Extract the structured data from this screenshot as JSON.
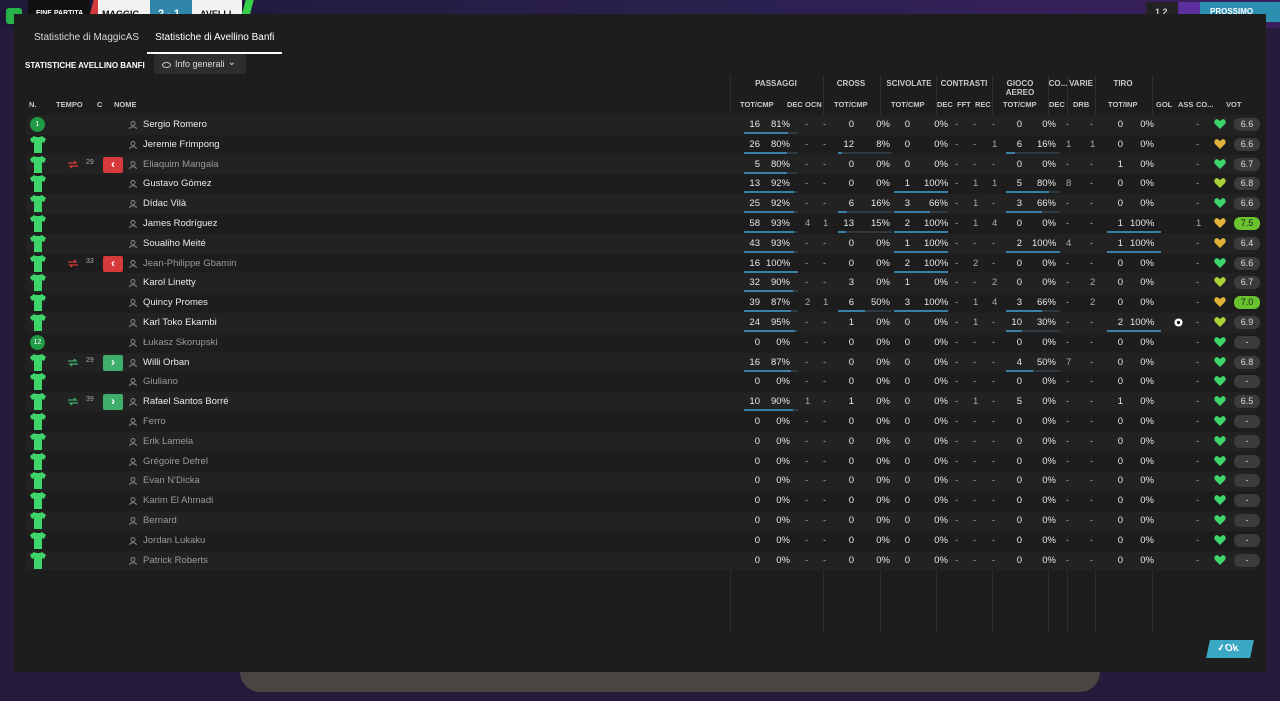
{
  "topbar": {
    "label": "FINE PARTITA",
    "home": "MAGGIC",
    "score": "2 - 1",
    "away": "AVELLI",
    "right_label": "1 2",
    "right_button": "PROSSIMO"
  },
  "tabs": [
    {
      "label": "Statistiche di MaggicAS",
      "active": false
    },
    {
      "label": "Statistiche di Avellino Banfi",
      "active": true
    }
  ],
  "section_title": "STATISTICHE AVELLINO BANFI",
  "view_select": {
    "value": "Info generali"
  },
  "groups": {
    "passaggi": "PASSAGGI",
    "cross": "CROSS",
    "scivolate": "SCIVOLATE",
    "contrasti": "CONTRASTI",
    "gioco_aereo": "GIOCO AEREO",
    "co": "CO...",
    "varie": "VARIE",
    "tiro": "TIRO"
  },
  "headers": {
    "n": "N.",
    "tempo": "TEMPO",
    "c": "C",
    "nome": "NOME",
    "pass_totcmp": "TOT/CMP",
    "pass_dec": "DEC",
    "pass_ocn": "OCN",
    "cross_totcmp": "TOT/CMP",
    "sciv_totcmp": "TOT/CMP",
    "con_dec": "DEC",
    "con_fft": "FFT",
    "con_rec": "REC",
    "aereo_totcmp": "TOT/CMP",
    "co_dec": "DEC",
    "varie_drb": "DRB",
    "tiro_totinp": "TOT/INP",
    "gol": "GOL",
    "ass": "ASS",
    "co2": "CO...",
    "vot": "VOT"
  },
  "players": [
    {
      "n": "1",
      "badge": true,
      "sub": "",
      "minute": "",
      "name": "Sergio Romero",
      "pass": [
        "16",
        "81%"
      ],
      "pdec": "-",
      "pocn": "-",
      "cross": [
        "0",
        "0%"
      ],
      "sciv": [
        "0",
        "0%"
      ],
      "cdec": "-",
      "cfft": "-",
      "crec": "-",
      "aereo": [
        "0",
        "0%"
      ],
      "codec": "-",
      "drb": "-",
      "tiro": [
        "0",
        "0%"
      ],
      "gol": "",
      "ass": "-",
      "heart": "#3ed66a",
      "vot": "6.6",
      "best": false,
      "bars": [
        0.81,
        0,
        0,
        0,
        0
      ]
    },
    {
      "n": "",
      "badge": false,
      "sub": "",
      "minute": "",
      "name": "Jeremie Frimpong",
      "pass": [
        "26",
        "80%"
      ],
      "pdec": "-",
      "pocn": "-",
      "cross": [
        "12",
        "8%"
      ],
      "sciv": [
        "0",
        "0%"
      ],
      "cdec": "-",
      "cfft": "-",
      "crec": "1",
      "aereo": [
        "6",
        "16%"
      ],
      "codec": "1",
      "drb": "1",
      "tiro": [
        "0",
        "0%"
      ],
      "gol": "",
      "ass": "-",
      "heart": "#e0b23a",
      "vot": "6.6",
      "best": false,
      "bars": [
        0.8,
        0.08,
        0,
        0.16,
        0
      ]
    },
    {
      "n": "",
      "badge": false,
      "sub": "out",
      "minute": "29",
      "name": "Eliaquim Mangala",
      "pass": [
        "5",
        "80%"
      ],
      "pdec": "-",
      "pocn": "-",
      "cross": [
        "0",
        "0%"
      ],
      "sciv": [
        "0",
        "0%"
      ],
      "cdec": "-",
      "cfft": "-",
      "crec": "-",
      "aereo": [
        "0",
        "0%"
      ],
      "codec": "-",
      "drb": "-",
      "tiro": [
        "1",
        "0%"
      ],
      "gol": "",
      "ass": "-",
      "heart": "#3ed66a",
      "vot": "6.7",
      "best": false,
      "bars": [
        0.8,
        0,
        0,
        0,
        0
      ]
    },
    {
      "n": "",
      "badge": false,
      "sub": "",
      "minute": "",
      "name": "Gustavo Gómez",
      "pass": [
        "13",
        "92%"
      ],
      "pdec": "-",
      "pocn": "-",
      "cross": [
        "0",
        "0%"
      ],
      "sciv": [
        "1",
        "100%"
      ],
      "cdec": "-",
      "cfft": "1",
      "crec": "1",
      "aereo": [
        "5",
        "80%"
      ],
      "codec": "8",
      "drb": "-",
      "tiro": [
        "0",
        "0%"
      ],
      "gol": "",
      "ass": "-",
      "heart": "#a8d43a",
      "vot": "6.8",
      "best": false,
      "bars": [
        0.92,
        0,
        1,
        0.8,
        0
      ]
    },
    {
      "n": "",
      "badge": false,
      "sub": "",
      "minute": "",
      "name": "Dídac Vilà",
      "pass": [
        "25",
        "92%"
      ],
      "pdec": "-",
      "pocn": "-",
      "cross": [
        "6",
        "16%"
      ],
      "sciv": [
        "3",
        "66%"
      ],
      "cdec": "-",
      "cfft": "1",
      "crec": "-",
      "aereo": [
        "3",
        "66%"
      ],
      "codec": "-",
      "drb": "-",
      "tiro": [
        "0",
        "0%"
      ],
      "gol": "",
      "ass": "-",
      "heart": "#3ed66a",
      "vot": "6.6",
      "best": false,
      "bars": [
        0.92,
        0.16,
        0.66,
        0.66,
        0
      ]
    },
    {
      "n": "",
      "badge": false,
      "sub": "",
      "minute": "",
      "name": "James Rodríguez",
      "pass": [
        "58",
        "93%"
      ],
      "pdec": "4",
      "pocn": "1",
      "cross": [
        "13",
        "15%"
      ],
      "sciv": [
        "2",
        "100%"
      ],
      "cdec": "-",
      "cfft": "1",
      "crec": "4",
      "aereo": [
        "0",
        "0%"
      ],
      "codec": "-",
      "drb": "-",
      "tiro": [
        "1",
        "100%"
      ],
      "gol": "",
      "ass": "1",
      "heart": "#e0b23a",
      "vot": "7.5",
      "best": true,
      "bars": [
        0.93,
        0.15,
        1,
        0,
        1
      ]
    },
    {
      "n": "",
      "badge": false,
      "sub": "",
      "minute": "",
      "name": "Soualiho Meité",
      "pass": [
        "43",
        "93%"
      ],
      "pdec": "-",
      "pocn": "-",
      "cross": [
        "0",
        "0%"
      ],
      "sciv": [
        "1",
        "100%"
      ],
      "cdec": "-",
      "cfft": "-",
      "crec": "-",
      "aereo": [
        "2",
        "100%"
      ],
      "codec": "4",
      "drb": "-",
      "tiro": [
        "1",
        "100%"
      ],
      "gol": "",
      "ass": "-",
      "heart": "#e0b23a",
      "vot": "6.4",
      "best": false,
      "bars": [
        0.93,
        0,
        1,
        1,
        1
      ]
    },
    {
      "n": "",
      "badge": false,
      "sub": "out",
      "minute": "33",
      "name": "Jean-Philippe Gbamin",
      "pass": [
        "16",
        "100%"
      ],
      "pdec": "-",
      "pocn": "-",
      "cross": [
        "0",
        "0%"
      ],
      "sciv": [
        "2",
        "100%"
      ],
      "cdec": "-",
      "cfft": "2",
      "crec": "-",
      "aereo": [
        "0",
        "0%"
      ],
      "codec": "-",
      "drb": "-",
      "tiro": [
        "0",
        "0%"
      ],
      "gol": "",
      "ass": "-",
      "heart": "#3ed66a",
      "vot": "6.6",
      "best": false,
      "bars": [
        1,
        0,
        1,
        0,
        0
      ]
    },
    {
      "n": "",
      "badge": false,
      "sub": "",
      "minute": "",
      "name": "Karol Linetty",
      "pass": [
        "32",
        "90%"
      ],
      "pdec": "-",
      "pocn": "-",
      "cross": [
        "3",
        "0%"
      ],
      "sciv": [
        "1",
        "0%"
      ],
      "cdec": "-",
      "cfft": "-",
      "crec": "2",
      "aereo": [
        "0",
        "0%"
      ],
      "codec": "-",
      "drb": "2",
      "tiro": [
        "0",
        "0%"
      ],
      "gol": "",
      "ass": "-",
      "heart": "#a8d43a",
      "vot": "6.7",
      "best": false,
      "bars": [
        0.9,
        0,
        0,
        0,
        0
      ]
    },
    {
      "n": "",
      "badge": false,
      "sub": "",
      "minute": "",
      "name": "Quincy Promes",
      "pass": [
        "39",
        "87%"
      ],
      "pdec": "2",
      "pocn": "1",
      "cross": [
        "6",
        "50%"
      ],
      "sciv": [
        "3",
        "100%"
      ],
      "cdec": "-",
      "cfft": "1",
      "crec": "4",
      "aereo": [
        "3",
        "66%"
      ],
      "codec": "-",
      "drb": "2",
      "tiro": [
        "0",
        "0%"
      ],
      "gol": "",
      "ass": "-",
      "heart": "#e0b23a",
      "vot": "7.0",
      "best": true,
      "bars": [
        0.87,
        0.5,
        1,
        0.66,
        0
      ]
    },
    {
      "n": "",
      "badge": false,
      "sub": "",
      "minute": "",
      "name": "Karl Toko Ekambi",
      "pass": [
        "24",
        "95%"
      ],
      "pdec": "-",
      "pocn": "-",
      "cross": [
        "1",
        "0%"
      ],
      "sciv": [
        "0",
        "0%"
      ],
      "cdec": "-",
      "cfft": "1",
      "crec": "-",
      "aereo": [
        "10",
        "30%"
      ],
      "codec": "-",
      "drb": "-",
      "tiro": [
        "2",
        "100%"
      ],
      "gol": "ball",
      "ass": "-",
      "heart": "#a8d43a",
      "vot": "6.9",
      "best": false,
      "bars": [
        0.95,
        0,
        0,
        0.3,
        1
      ]
    },
    {
      "n": "12",
      "badge": true,
      "sub": "",
      "minute": "",
      "name": "Łukasz Skorupski",
      "pass": [
        "0",
        "0%"
      ],
      "pdec": "-",
      "pocn": "-",
      "cross": [
        "0",
        "0%"
      ],
      "sciv": [
        "0",
        "0%"
      ],
      "cdec": "-",
      "cfft": "-",
      "crec": "-",
      "aereo": [
        "0",
        "0%"
      ],
      "codec": "-",
      "drb": "-",
      "tiro": [
        "0",
        "0%"
      ],
      "gol": "",
      "ass": "-",
      "heart": "#3ed66a",
      "vot": "-",
      "best": false,
      "bars": [
        0,
        0,
        0,
        0,
        0
      ],
      "dim": true
    },
    {
      "n": "",
      "badge": false,
      "sub": "in",
      "minute": "29",
      "name": "Willi Orban",
      "pass": [
        "16",
        "87%"
      ],
      "pdec": "-",
      "pocn": "-",
      "cross": [
        "0",
        "0%"
      ],
      "sciv": [
        "0",
        "0%"
      ],
      "cdec": "-",
      "cfft": "-",
      "crec": "-",
      "aereo": [
        "4",
        "50%"
      ],
      "codec": "7",
      "drb": "-",
      "tiro": [
        "0",
        "0%"
      ],
      "gol": "",
      "ass": "-",
      "heart": "#3ed66a",
      "vot": "6.8",
      "best": false,
      "bars": [
        0.87,
        0,
        0,
        0.5,
        0
      ]
    },
    {
      "n": "",
      "badge": false,
      "sub": "",
      "minute": "",
      "name": "Giuliano",
      "pass": [
        "0",
        "0%"
      ],
      "pdec": "-",
      "pocn": "-",
      "cross": [
        "0",
        "0%"
      ],
      "sciv": [
        "0",
        "0%"
      ],
      "cdec": "-",
      "cfft": "-",
      "crec": "-",
      "aereo": [
        "0",
        "0%"
      ],
      "codec": "-",
      "drb": "-",
      "tiro": [
        "0",
        "0%"
      ],
      "gol": "",
      "ass": "-",
      "heart": "#3ed66a",
      "vot": "-",
      "best": false,
      "bars": [
        0,
        0,
        0,
        0,
        0
      ],
      "dim": true
    },
    {
      "n": "",
      "badge": false,
      "sub": "in",
      "minute": "39",
      "name": "Rafael Santos Borré",
      "pass": [
        "10",
        "90%"
      ],
      "pdec": "1",
      "pocn": "-",
      "cross": [
        "1",
        "0%"
      ],
      "sciv": [
        "0",
        "0%"
      ],
      "cdec": "-",
      "cfft": "1",
      "crec": "-",
      "aereo": [
        "5",
        "0%"
      ],
      "codec": "-",
      "drb": "-",
      "tiro": [
        "1",
        "0%"
      ],
      "gol": "",
      "ass": "-",
      "heart": "#3ed66a",
      "vot": "6.5",
      "best": false,
      "bars": [
        0.9,
        0,
        0,
        0,
        0
      ]
    },
    {
      "n": "",
      "badge": false,
      "sub": "",
      "minute": "",
      "name": "Ferro",
      "pass": [
        "0",
        "0%"
      ],
      "pdec": "-",
      "pocn": "-",
      "cross": [
        "0",
        "0%"
      ],
      "sciv": [
        "0",
        "0%"
      ],
      "cdec": "-",
      "cfft": "-",
      "crec": "-",
      "aereo": [
        "0",
        "0%"
      ],
      "codec": "-",
      "drb": "-",
      "tiro": [
        "0",
        "0%"
      ],
      "gol": "",
      "ass": "-",
      "heart": "#3ed66a",
      "vot": "-",
      "best": false,
      "bars": [
        0,
        0,
        0,
        0,
        0
      ],
      "dim": true
    },
    {
      "n": "",
      "badge": false,
      "sub": "",
      "minute": "",
      "name": "Erik Lamela",
      "pass": [
        "0",
        "0%"
      ],
      "pdec": "-",
      "pocn": "-",
      "cross": [
        "0",
        "0%"
      ],
      "sciv": [
        "0",
        "0%"
      ],
      "cdec": "-",
      "cfft": "-",
      "crec": "-",
      "aereo": [
        "0",
        "0%"
      ],
      "codec": "-",
      "drb": "-",
      "tiro": [
        "0",
        "0%"
      ],
      "gol": "",
      "ass": "-",
      "heart": "#3ed66a",
      "vot": "-",
      "best": false,
      "bars": [
        0,
        0,
        0,
        0,
        0
      ],
      "dim": true
    },
    {
      "n": "",
      "badge": false,
      "sub": "",
      "minute": "",
      "name": "Grégoire Defrel",
      "pass": [
        "0",
        "0%"
      ],
      "pdec": "-",
      "pocn": "-",
      "cross": [
        "0",
        "0%"
      ],
      "sciv": [
        "0",
        "0%"
      ],
      "cdec": "-",
      "cfft": "-",
      "crec": "-",
      "aereo": [
        "0",
        "0%"
      ],
      "codec": "-",
      "drb": "-",
      "tiro": [
        "0",
        "0%"
      ],
      "gol": "",
      "ass": "-",
      "heart": "#3ed66a",
      "vot": "-",
      "best": false,
      "bars": [
        0,
        0,
        0,
        0,
        0
      ],
      "dim": true
    },
    {
      "n": "",
      "badge": false,
      "sub": "",
      "minute": "",
      "name": "Evan N'Dicka",
      "pass": [
        "0",
        "0%"
      ],
      "pdec": "-",
      "pocn": "-",
      "cross": [
        "0",
        "0%"
      ],
      "sciv": [
        "0",
        "0%"
      ],
      "cdec": "-",
      "cfft": "-",
      "crec": "-",
      "aereo": [
        "0",
        "0%"
      ],
      "codec": "-",
      "drb": "-",
      "tiro": [
        "0",
        "0%"
      ],
      "gol": "",
      "ass": "-",
      "heart": "#3ed66a",
      "vot": "-",
      "best": false,
      "bars": [
        0,
        0,
        0,
        0,
        0
      ],
      "dim": true
    },
    {
      "n": "",
      "badge": false,
      "sub": "",
      "minute": "",
      "name": "Karim El Ahmadi",
      "pass": [
        "0",
        "0%"
      ],
      "pdec": "-",
      "pocn": "-",
      "cross": [
        "0",
        "0%"
      ],
      "sciv": [
        "0",
        "0%"
      ],
      "cdec": "-",
      "cfft": "-",
      "crec": "-",
      "aereo": [
        "0",
        "0%"
      ],
      "codec": "-",
      "drb": "-",
      "tiro": [
        "0",
        "0%"
      ],
      "gol": "",
      "ass": "-",
      "heart": "#3ed66a",
      "vot": "-",
      "best": false,
      "bars": [
        0,
        0,
        0,
        0,
        0
      ],
      "dim": true
    },
    {
      "n": "",
      "badge": false,
      "sub": "",
      "minute": "",
      "name": "Bernard",
      "pass": [
        "0",
        "0%"
      ],
      "pdec": "-",
      "pocn": "-",
      "cross": [
        "0",
        "0%"
      ],
      "sciv": [
        "0",
        "0%"
      ],
      "cdec": "-",
      "cfft": "-",
      "crec": "-",
      "aereo": [
        "0",
        "0%"
      ],
      "codec": "-",
      "drb": "-",
      "tiro": [
        "0",
        "0%"
      ],
      "gol": "",
      "ass": "-",
      "heart": "#3ed66a",
      "vot": "-",
      "best": false,
      "bars": [
        0,
        0,
        0,
        0,
        0
      ],
      "dim": true
    },
    {
      "n": "",
      "badge": false,
      "sub": "",
      "minute": "",
      "name": "Jordan Lukaku",
      "pass": [
        "0",
        "0%"
      ],
      "pdec": "-",
      "pocn": "-",
      "cross": [
        "0",
        "0%"
      ],
      "sciv": [
        "0",
        "0%"
      ],
      "cdec": "-",
      "cfft": "-",
      "crec": "-",
      "aereo": [
        "0",
        "0%"
      ],
      "codec": "-",
      "drb": "-",
      "tiro": [
        "0",
        "0%"
      ],
      "gol": "",
      "ass": "-",
      "heart": "#3ed66a",
      "vot": "-",
      "best": false,
      "bars": [
        0,
        0,
        0,
        0,
        0
      ],
      "dim": true
    },
    {
      "n": "",
      "badge": false,
      "sub": "",
      "minute": "",
      "name": "Patrick Roberts",
      "pass": [
        "0",
        "0%"
      ],
      "pdec": "-",
      "pocn": "-",
      "cross": [
        "0",
        "0%"
      ],
      "sciv": [
        "0",
        "0%"
      ],
      "cdec": "-",
      "cfft": "-",
      "crec": "-",
      "aereo": [
        "0",
        "0%"
      ],
      "codec": "-",
      "drb": "-",
      "tiro": [
        "0",
        "0%"
      ],
      "gol": "",
      "ass": "-",
      "heart": "#3ed66a",
      "vot": "-",
      "best": false,
      "bars": [
        0,
        0,
        0,
        0,
        0
      ],
      "dim": true
    }
  ],
  "ok_button": "Ok",
  "colors": {
    "shirt": "#3ed66a",
    "accent": "#3aa7c4",
    "sub_out": "#d63a3a",
    "sub_in": "#3fae6a",
    "best_rating": "#6ac22e"
  }
}
